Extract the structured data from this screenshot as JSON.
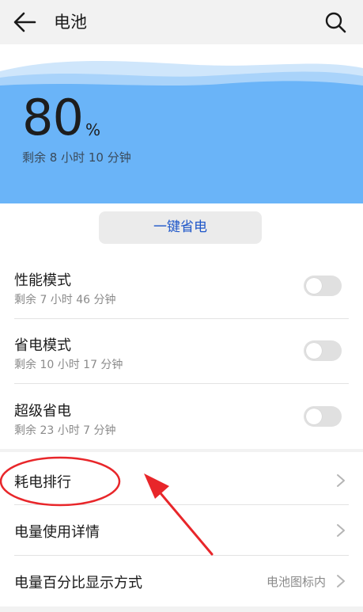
{
  "header": {
    "title": "电池",
    "back_icon": "arrow-left-icon",
    "search_icon": "search-icon"
  },
  "battery": {
    "percent": "80",
    "percent_sign": "%",
    "remaining": "剩余 8 小时 10 分钟",
    "accent_color": "#6ab4f8"
  },
  "save_button": {
    "label": "一键省电"
  },
  "modes": [
    {
      "title": "性能模式",
      "subtitle": "剩余 7 小时 46 分钟",
      "enabled": false
    },
    {
      "title": "省电模式",
      "subtitle": "剩余 10 小时 17 分钟",
      "enabled": false
    },
    {
      "title": "超级省电",
      "subtitle": "剩余 23 小时 7 分钟",
      "enabled": false
    }
  ],
  "menu": [
    {
      "label": "耗电排行"
    },
    {
      "label": "电量使用详情"
    },
    {
      "label": "电量百分比显示方式",
      "value": "电池图标内"
    }
  ],
  "annotation": {
    "color": "#e8262a"
  }
}
